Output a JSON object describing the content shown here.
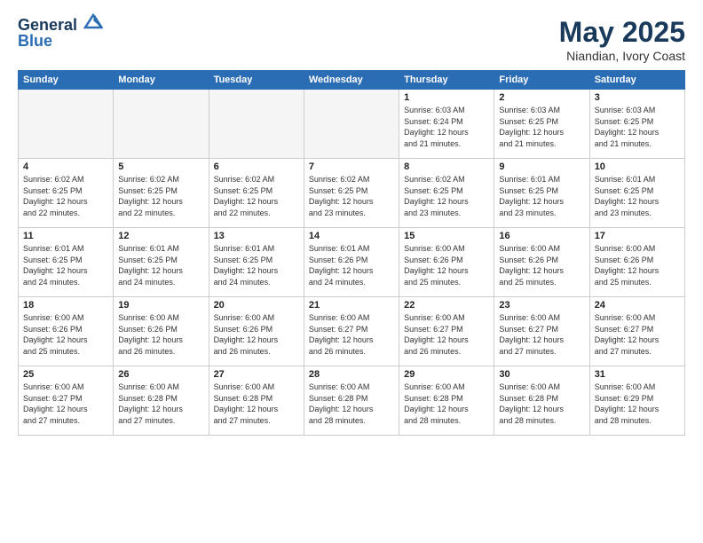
{
  "header": {
    "logo_line1": "General",
    "logo_line2": "Blue",
    "month_title": "May 2025",
    "subtitle": "Niandian, Ivory Coast"
  },
  "days_of_week": [
    "Sunday",
    "Monday",
    "Tuesday",
    "Wednesday",
    "Thursday",
    "Friday",
    "Saturday"
  ],
  "weeks": [
    [
      {
        "day": "",
        "info": ""
      },
      {
        "day": "",
        "info": ""
      },
      {
        "day": "",
        "info": ""
      },
      {
        "day": "",
        "info": ""
      },
      {
        "day": "1",
        "info": "Sunrise: 6:03 AM\nSunset: 6:24 PM\nDaylight: 12 hours\nand 21 minutes."
      },
      {
        "day": "2",
        "info": "Sunrise: 6:03 AM\nSunset: 6:25 PM\nDaylight: 12 hours\nand 21 minutes."
      },
      {
        "day": "3",
        "info": "Sunrise: 6:03 AM\nSunset: 6:25 PM\nDaylight: 12 hours\nand 21 minutes."
      }
    ],
    [
      {
        "day": "4",
        "info": "Sunrise: 6:02 AM\nSunset: 6:25 PM\nDaylight: 12 hours\nand 22 minutes."
      },
      {
        "day": "5",
        "info": "Sunrise: 6:02 AM\nSunset: 6:25 PM\nDaylight: 12 hours\nand 22 minutes."
      },
      {
        "day": "6",
        "info": "Sunrise: 6:02 AM\nSunset: 6:25 PM\nDaylight: 12 hours\nand 22 minutes."
      },
      {
        "day": "7",
        "info": "Sunrise: 6:02 AM\nSunset: 6:25 PM\nDaylight: 12 hours\nand 23 minutes."
      },
      {
        "day": "8",
        "info": "Sunrise: 6:02 AM\nSunset: 6:25 PM\nDaylight: 12 hours\nand 23 minutes."
      },
      {
        "day": "9",
        "info": "Sunrise: 6:01 AM\nSunset: 6:25 PM\nDaylight: 12 hours\nand 23 minutes."
      },
      {
        "day": "10",
        "info": "Sunrise: 6:01 AM\nSunset: 6:25 PM\nDaylight: 12 hours\nand 23 minutes."
      }
    ],
    [
      {
        "day": "11",
        "info": "Sunrise: 6:01 AM\nSunset: 6:25 PM\nDaylight: 12 hours\nand 24 minutes."
      },
      {
        "day": "12",
        "info": "Sunrise: 6:01 AM\nSunset: 6:25 PM\nDaylight: 12 hours\nand 24 minutes."
      },
      {
        "day": "13",
        "info": "Sunrise: 6:01 AM\nSunset: 6:25 PM\nDaylight: 12 hours\nand 24 minutes."
      },
      {
        "day": "14",
        "info": "Sunrise: 6:01 AM\nSunset: 6:26 PM\nDaylight: 12 hours\nand 24 minutes."
      },
      {
        "day": "15",
        "info": "Sunrise: 6:00 AM\nSunset: 6:26 PM\nDaylight: 12 hours\nand 25 minutes."
      },
      {
        "day": "16",
        "info": "Sunrise: 6:00 AM\nSunset: 6:26 PM\nDaylight: 12 hours\nand 25 minutes."
      },
      {
        "day": "17",
        "info": "Sunrise: 6:00 AM\nSunset: 6:26 PM\nDaylight: 12 hours\nand 25 minutes."
      }
    ],
    [
      {
        "day": "18",
        "info": "Sunrise: 6:00 AM\nSunset: 6:26 PM\nDaylight: 12 hours\nand 25 minutes."
      },
      {
        "day": "19",
        "info": "Sunrise: 6:00 AM\nSunset: 6:26 PM\nDaylight: 12 hours\nand 26 minutes."
      },
      {
        "day": "20",
        "info": "Sunrise: 6:00 AM\nSunset: 6:26 PM\nDaylight: 12 hours\nand 26 minutes."
      },
      {
        "day": "21",
        "info": "Sunrise: 6:00 AM\nSunset: 6:27 PM\nDaylight: 12 hours\nand 26 minutes."
      },
      {
        "day": "22",
        "info": "Sunrise: 6:00 AM\nSunset: 6:27 PM\nDaylight: 12 hours\nand 26 minutes."
      },
      {
        "day": "23",
        "info": "Sunrise: 6:00 AM\nSunset: 6:27 PM\nDaylight: 12 hours\nand 27 minutes."
      },
      {
        "day": "24",
        "info": "Sunrise: 6:00 AM\nSunset: 6:27 PM\nDaylight: 12 hours\nand 27 minutes."
      }
    ],
    [
      {
        "day": "25",
        "info": "Sunrise: 6:00 AM\nSunset: 6:27 PM\nDaylight: 12 hours\nand 27 minutes."
      },
      {
        "day": "26",
        "info": "Sunrise: 6:00 AM\nSunset: 6:28 PM\nDaylight: 12 hours\nand 27 minutes."
      },
      {
        "day": "27",
        "info": "Sunrise: 6:00 AM\nSunset: 6:28 PM\nDaylight: 12 hours\nand 27 minutes."
      },
      {
        "day": "28",
        "info": "Sunrise: 6:00 AM\nSunset: 6:28 PM\nDaylight: 12 hours\nand 28 minutes."
      },
      {
        "day": "29",
        "info": "Sunrise: 6:00 AM\nSunset: 6:28 PM\nDaylight: 12 hours\nand 28 minutes."
      },
      {
        "day": "30",
        "info": "Sunrise: 6:00 AM\nSunset: 6:28 PM\nDaylight: 12 hours\nand 28 minutes."
      },
      {
        "day": "31",
        "info": "Sunrise: 6:00 AM\nSunset: 6:29 PM\nDaylight: 12 hours\nand 28 minutes."
      }
    ]
  ]
}
